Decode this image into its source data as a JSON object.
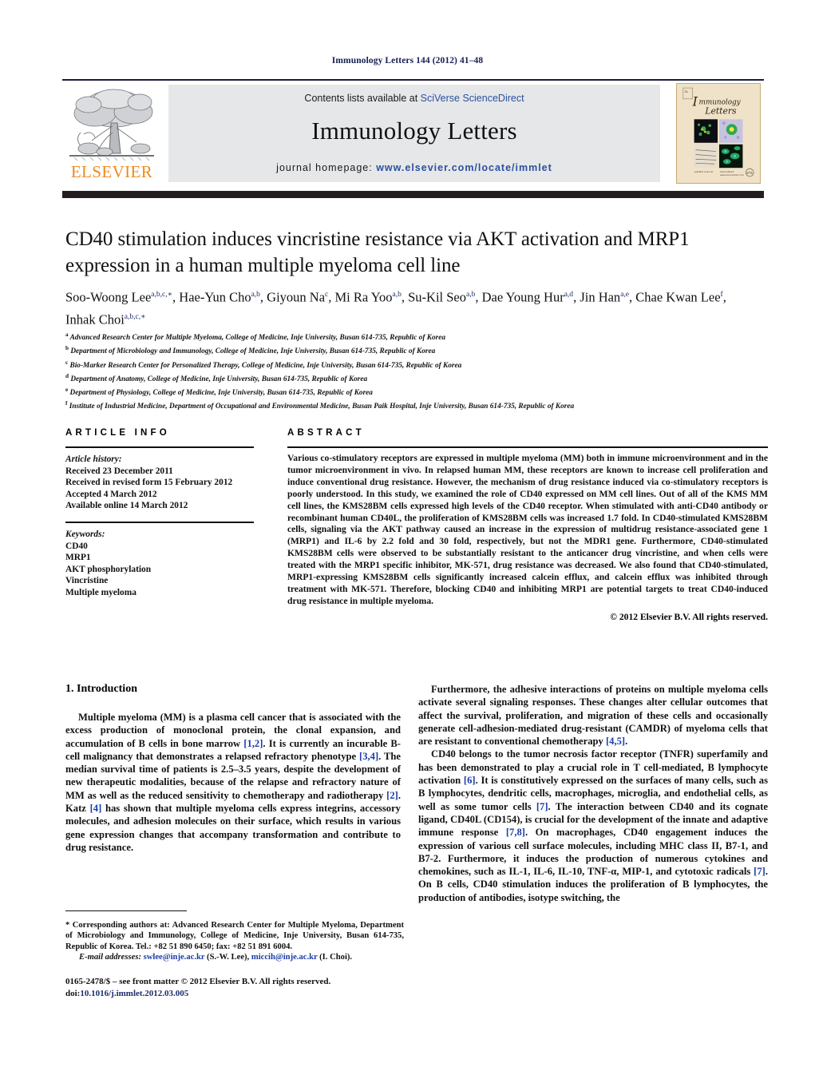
{
  "running_head": "Immunology Letters 144 (2012) 41–48",
  "masthead": {
    "publisher_name": "ELSEVIER",
    "contents_prefix": "Contents lists available at ",
    "contents_link": "SciVerse ScienceDirect",
    "journal_name": "Immunology Letters",
    "homepage_prefix": "journal homepage: ",
    "homepage_url": "www.elsevier.com/locate/immlet",
    "link_color": "#2b50a1",
    "banner_bg": "#e6e7e9",
    "brand_color": "#f08a1b",
    "cover_alt": "Immunology Letters journal cover"
  },
  "article": {
    "title": "CD40 stimulation induces vincristine resistance via AKT activation and MRP1 expression in a human multiple myeloma cell line",
    "authors": [
      {
        "name": "Soo-Woong Lee",
        "sup": "a,b,c,",
        "star": true,
        "sep": ", "
      },
      {
        "name": "Hae-Yun Cho",
        "sup": "a,b",
        "star": false,
        "sep": ", "
      },
      {
        "name": "Giyoun Na",
        "sup": "c",
        "star": false,
        "sep": ", "
      },
      {
        "name": "Mi Ra Yoo",
        "sup": "a,b",
        "star": false,
        "sep": ", "
      },
      {
        "name": "Su-Kil Seo",
        "sup": "a,b",
        "star": false,
        "sep": ", "
      },
      {
        "name": "Dae Young Hur",
        "sup": "a,d",
        "star": false,
        "sep": ", "
      },
      {
        "name": "Jin Han",
        "sup": "a,e",
        "star": false,
        "sep": ", "
      },
      {
        "name": "Chae Kwan Lee",
        "sup": "f",
        "star": false,
        "sep": ", "
      },
      {
        "name": "Inhak Choi",
        "sup": "a,b,c,",
        "star": true,
        "sep": ""
      }
    ],
    "affiliations": [
      {
        "label": "a",
        "text": "Advanced Research Center for Multiple Myeloma, College of Medicine, Inje University, Busan 614-735, Republic of Korea"
      },
      {
        "label": "b",
        "text": "Department of Microbiology and Immunology, College of Medicine, Inje University, Busan 614-735, Republic of Korea"
      },
      {
        "label": "c",
        "text": "Bio-Marker Research Center for Personalized Therapy, College of Medicine, Inje University, Busan 614-735, Republic of Korea"
      },
      {
        "label": "d",
        "text": "Department of Anatomy, College of Medicine, Inje University, Busan 614-735, Republic of Korea"
      },
      {
        "label": "e",
        "text": "Department of Physiology, College of Medicine, Inje University, Busan 614-735, Republic of Korea"
      },
      {
        "label": "f",
        "text": "Institute of Industrial Medicine, Department of Occupational and Environmental Medicine, Busan Paik Hospital, Inje University, Busan 614-735, Republic of Korea"
      }
    ]
  },
  "article_info": {
    "heading": "ARTICLE INFO",
    "history_label": "Article history:",
    "history": [
      "Received 23 December 2011",
      "Received in revised form 15 February 2012",
      "Accepted 4 March 2012",
      "Available online 14 March 2012"
    ],
    "keywords_label": "Keywords:",
    "keywords": [
      "CD40",
      "MRP1",
      "AKT phosphorylation",
      "Vincristine",
      "Multiple myeloma"
    ]
  },
  "abstract": {
    "heading": "ABSTRACT",
    "text": "Various co-stimulatory receptors are expressed in multiple myeloma (MM) both in immune microenvironment and in the tumor microenvironment in vivo. In relapsed human MM, these receptors are known to increase cell proliferation and induce conventional drug resistance. However, the mechanism of drug resistance induced via co-stimulatory receptors is poorly understood. In this study, we examined the role of CD40 expressed on MM cell lines. Out of all of the KMS MM cell lines, the KMS28BM cells expressed high levels of the CD40 receptor. When stimulated with anti-CD40 antibody or recombinant human CD40L, the proliferation of KMS28BM cells was increased 1.7 fold. In CD40-stimulated KMS28BM cells, signaling via the AKT pathway caused an increase in the expression of multidrug resistance-associated gene 1 (MRP1) and IL-6 by 2.2 fold and 30 fold, respectively, but not the MDR1 gene. Furthermore, CD40-stimulated KMS28BM cells were observed to be substantially resistant to the anticancer drug vincristine, and when cells were treated with the MRP1 specific inhibitor, MK-571, drug resistance was decreased. We also found that CD40-stimulated, MRP1-expressing KMS28BM cells significantly increased calcein efflux, and calcein efflux was inhibited through treatment with MK-571. Therefore, blocking CD40 and inhibiting MRP1 are potential targets to treat CD40-induced drug resistance in multiple myeloma.",
    "copyright": "© 2012 Elsevier B.V. All rights reserved."
  },
  "body": {
    "section_title": "1. Introduction",
    "left_paragraphs": [
      "Multiple myeloma (MM) is a plasma cell cancer that is associated with the excess production of monoclonal protein, the clonal expansion, and accumulation of B cells in bone marrow [1,2]. It is currently an incurable B-cell malignancy that demonstrates a relapsed refractory phenotype [3,4]. The median survival time of patients is 2.5–3.5 years, despite the development of new therapeutic modalities, because of the relapse and refractory nature of MM as well as the reduced sensitivity to chemotherapy and radiotherapy [2]. Katz [4] has shown that multiple myeloma cells express integrins, accessory molecules, and adhesion molecules on their surface, which results in various gene expression changes that accompany transformation and contribute to drug resistance."
    ],
    "right_paragraphs": [
      "Furthermore, the adhesive interactions of proteins on multiple myeloma cells activate several signaling responses. These changes alter cellular outcomes that affect the survival, proliferation, and migration of these cells and occasionally generate cell-adhesion-mediated drug-resistant (CAMDR) of myeloma cells that are resistant to conventional chemotherapy [4,5].",
      "CD40 belongs to the tumor necrosis factor receptor (TNFR) superfamily and has been demonstrated to play a crucial role in T cell-mediated, B lymphocyte activation [6]. It is constitutively expressed on the surfaces of many cells, such as B lymphocytes, dendritic cells, macrophages, microglia, and endothelial cells, as well as some tumor cells [7]. The interaction between CD40 and its cognate ligand, CD40L (CD154), is crucial for the development of the innate and adaptive immune response [7,8]. On macrophages, CD40 engagement induces the expression of various cell surface molecules, including MHC class II, B7-1, and B7-2. Furthermore, it induces the production of numerous cytokines and chemokines, such as IL-1, IL-6, IL-10, TNF-α, MIP-1, and cytotoxic radicals [7]. On B cells, CD40 stimulation induces the proliferation of B lymphocytes, the production of antibodies, isotype switching, the"
    ]
  },
  "footnotes": {
    "corresponding": "* Corresponding authors at: Advanced Research Center for Multiple Myeloma, Department of Microbiology and Immunology, College of Medicine, Inje University, Busan 614-735, Republic of Korea. Tel.: +82 51 890 6450; fax: +82 51 891 6004.",
    "email_label": "E-mail addresses:",
    "email_1": "swlee@inje.ac.kr",
    "email_1_owner": "(S.-W. Lee),",
    "email_2": "miccih@inje.ac.kr",
    "email_2_owner": "(I. Choi).",
    "issn_line": "0165-2478/$ – see front matter © 2012 Elsevier B.V. All rights reserved.",
    "doi_prefix": "doi:",
    "doi_value": "10.1016/j.immlet.2012.03.005"
  }
}
